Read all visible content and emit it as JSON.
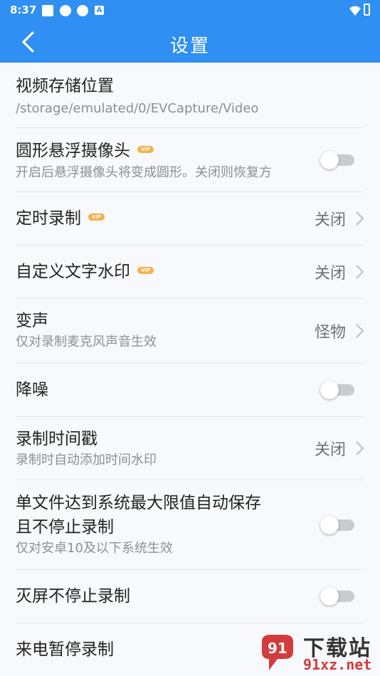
{
  "status_bar": {
    "time": "8:37",
    "notif_a": "A"
  },
  "app_bar": {
    "title": "设置"
  },
  "settings": [
    {
      "label": "视频存储位置",
      "sub": "/storage/emulated/0/EVCapture/Video"
    },
    {
      "label": "圆形悬浮摄像头",
      "vip": "VIP",
      "sub": "开启后悬浮摄像头将变成圆形。关闭则恢复方",
      "toggle": "off"
    },
    {
      "label": "定时录制",
      "vip": "VIP",
      "value": "关闭"
    },
    {
      "label": "自定义文字水印",
      "vip": "VIP",
      "value": "关闭"
    },
    {
      "label": "变声",
      "sub": "仅对录制麦克风声音生效",
      "value": "怪物"
    },
    {
      "label": "降噪",
      "toggle": "off"
    },
    {
      "label": "录制时间戳",
      "sub": "录制时自动添加时间水印",
      "value": "关闭"
    },
    {
      "label_line1": "单文件达到系统最大限值自动保存",
      "label_line2": "且不停止录制",
      "sub": "仅对安卓10及以下系统生效",
      "toggle": "off"
    },
    {
      "label": "灭屏不停止录制",
      "toggle": "off"
    },
    {
      "label": "来电暂停录制"
    }
  ],
  "watermark": {
    "brand_cn": "下载站",
    "brand_url": "91xz.net"
  },
  "colors": {
    "primary": "#2f8ff2",
    "vip_badge": "#f7b04a",
    "background": "#f8f9fd"
  }
}
